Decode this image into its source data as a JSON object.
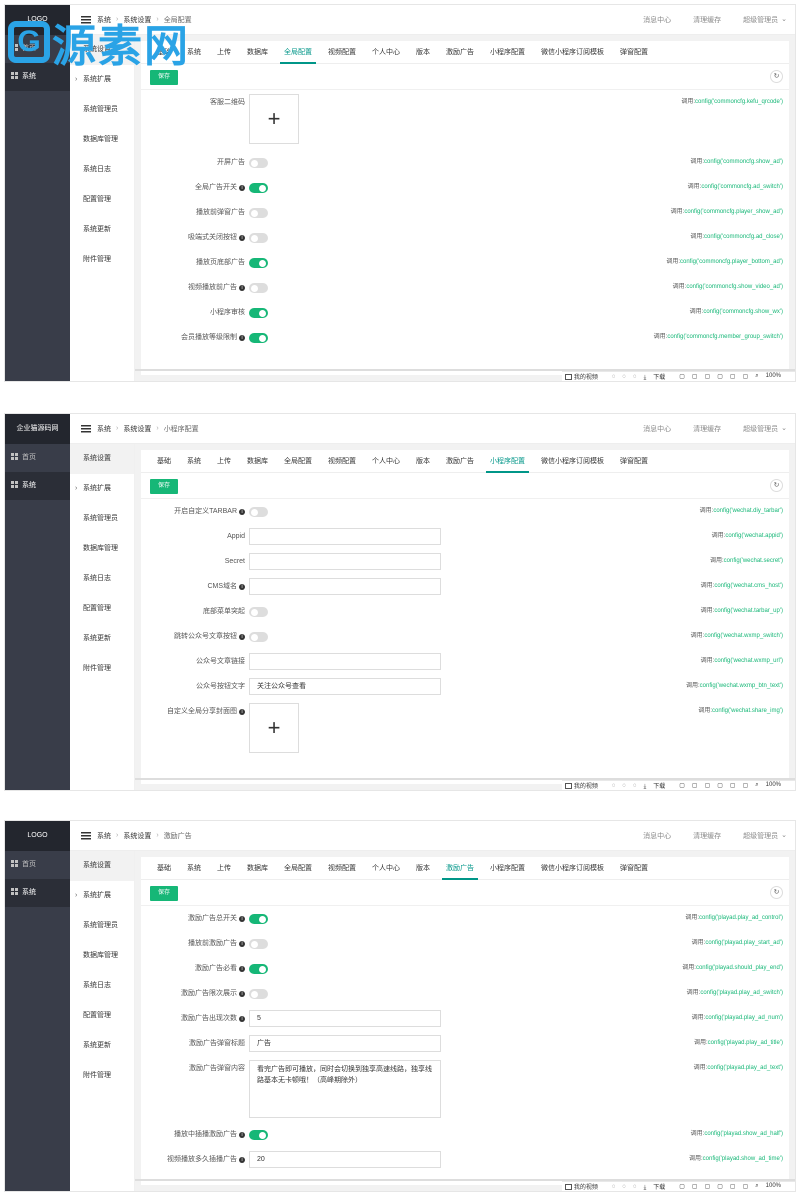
{
  "watermark": {
    "letter": "G",
    "text": "源素网"
  },
  "screens": [
    {
      "logo": "LOGO",
      "side_nav": [
        "首页",
        "系统"
      ],
      "breadcrumb": [
        "系统",
        "系统设置",
        "全局配置"
      ],
      "top_right": [
        "消息中心",
        "清理缓存",
        "超级管理员"
      ],
      "sub_menu": [
        "系统设置",
        "系统扩展",
        "系统管理员",
        "数据库管理",
        "系统日志",
        "配置管理",
        "系统更新",
        "附件管理"
      ],
      "tabs": [
        "基础",
        "系统",
        "上传",
        "数据库",
        "全局配置",
        "视频配置",
        "个人中心",
        "版本",
        "激励广告",
        "小程序配置",
        "微信小程序订阅模板",
        "弹窗配置"
      ],
      "active_tab": "全局配置",
      "save_label": "保存",
      "call_prefix": "调用:",
      "rows": [
        {
          "type": "upload",
          "label": "客服二维码",
          "icon": "plus-icon",
          "call": "config('commoncfg.kefu_qrcode')"
        },
        {
          "type": "switch",
          "label": "开屏广告",
          "on": false,
          "call": "config('commoncfg.show_ad')"
        },
        {
          "type": "switch",
          "label": "全局广告开关",
          "on": true,
          "info": true,
          "call": "config('commoncfg.ad_switch')"
        },
        {
          "type": "switch",
          "label": "播放前弹窗广告",
          "on": false,
          "call": "config('commoncfg.player_show_ad')"
        },
        {
          "type": "switch",
          "label": "吸端式关闭按钮",
          "on": false,
          "info": true,
          "call": "config('commoncfg.ad_close')"
        },
        {
          "type": "switch",
          "label": "播放页底部广告",
          "on": true,
          "call": "config('commoncfg.player_bottom_ad')"
        },
        {
          "type": "switch",
          "label": "视频播放前广告",
          "on": false,
          "info": true,
          "call": "config('commoncfg.show_video_ad')"
        },
        {
          "type": "switch",
          "label": "小程序审核",
          "on": true,
          "call": "config('commoncfg.show_wx')"
        },
        {
          "type": "switch",
          "label": "会员播放等级限制",
          "on": true,
          "info": true,
          "call": "config('commoncfg.member_group_switch')"
        }
      ],
      "status_items": [
        "我的视频",
        "下载",
        "100%"
      ]
    },
    {
      "logo": "企业猫源码网",
      "side_nav": [
        "首页",
        "系统"
      ],
      "breadcrumb": [
        "系统",
        "系统设置",
        "小程序配置"
      ],
      "top_right": [
        "消息中心",
        "清理缓存",
        "超级管理员"
      ],
      "sub_menu": [
        "系统设置",
        "系统扩展",
        "系统管理员",
        "数据库管理",
        "系统日志",
        "配置管理",
        "系统更新",
        "附件管理"
      ],
      "tabs": [
        "基础",
        "系统",
        "上传",
        "数据库",
        "全局配置",
        "视频配置",
        "个人中心",
        "版本",
        "激励广告",
        "小程序配置",
        "微信小程序订阅模板",
        "弹窗配置"
      ],
      "active_tab": "小程序配置",
      "save_label": "保存",
      "call_prefix": "调用:",
      "rows": [
        {
          "type": "switch",
          "label": "开启自定义TARBAR",
          "on": false,
          "info": true,
          "call": "config('wechat.diy_tarbar')"
        },
        {
          "type": "input",
          "label": "Appid",
          "value": "",
          "call": "config('wechat.appid')"
        },
        {
          "type": "input",
          "label": "Secret",
          "value": "",
          "call": "config('wechat.secret')"
        },
        {
          "type": "input",
          "label": "CMS域名",
          "value": "",
          "info": true,
          "call": "config('wechat.cms_host')"
        },
        {
          "type": "switch",
          "label": "底部菜单突起",
          "on": false,
          "call": "config('wechat.tarbar_up')"
        },
        {
          "type": "switch",
          "label": "跳转公众号文章按钮",
          "on": false,
          "info": true,
          "call": "config('wechat.wxmp_switch')"
        },
        {
          "type": "input",
          "label": "公众号文章链接",
          "value": "",
          "call": "config('wechat.wxmp_url')"
        },
        {
          "type": "input",
          "label": "公众号按钮文字",
          "value": "关注公众号查看",
          "call": "config('wechat.wxmp_btn_text')"
        },
        {
          "type": "upload",
          "label": "自定义全局分享封面图",
          "icon": "plus-icon",
          "info": true,
          "call": "config('wechat.share_img')"
        }
      ],
      "status_items": [
        "我的视频",
        "下载",
        "100%"
      ]
    },
    {
      "logo": "LOGO",
      "side_nav": [
        "首页",
        "系统"
      ],
      "breadcrumb": [
        "系统",
        "系统设置",
        "激励广告"
      ],
      "top_right": [
        "消息中心",
        "清理缓存",
        "超级管理员"
      ],
      "sub_menu": [
        "系统设置",
        "系统扩展",
        "系统管理员",
        "数据库管理",
        "系统日志",
        "配置管理",
        "系统更新",
        "附件管理"
      ],
      "tabs": [
        "基础",
        "系统",
        "上传",
        "数据库",
        "全局配置",
        "视频配置",
        "个人中心",
        "版本",
        "激励广告",
        "小程序配置",
        "微信小程序订阅模板",
        "弹窗配置"
      ],
      "active_tab": "激励广告",
      "save_label": "保存",
      "call_prefix": "调用:",
      "rows": [
        {
          "type": "switch",
          "label": "激励广告总开关",
          "on": true,
          "info": true,
          "call": "config('playad.play_ad_control')"
        },
        {
          "type": "switch",
          "label": "播放前激励广告",
          "on": false,
          "info": true,
          "call": "config('playad.play_start_ad')"
        },
        {
          "type": "switch",
          "label": "激励广告必看",
          "on": true,
          "info": true,
          "call": "config('playad.should_play_end')"
        },
        {
          "type": "switch",
          "label": "激励广告限次展示",
          "on": false,
          "info": true,
          "call": "config('playad.play_ad_switch')"
        },
        {
          "type": "input",
          "label": "激励广告出现次数",
          "value": "5",
          "info": true,
          "call": "config('playad.play_ad_num')"
        },
        {
          "type": "input",
          "label": "激励广告弹窗标题",
          "value": "广告",
          "call": "config('playad.play_ad_title')"
        },
        {
          "type": "textarea",
          "label": "激励广告弹窗内容",
          "value": "看完广告即可播放，同时会切换到独享高速线路，独享线路基本无卡顿哦！（高峰期除外）",
          "call": "config('playad.play_ad_text')"
        },
        {
          "type": "switch",
          "label": "播放中插播激励广告",
          "on": true,
          "info": true,
          "call": "config('playad.show_ad_half')"
        },
        {
          "type": "input",
          "label": "视频播放多久插播广告",
          "value": "20",
          "info": true,
          "call": "config('playad.show_ad_time')"
        }
      ],
      "status_items": [
        "我的视频",
        "下载",
        "100%"
      ]
    }
  ]
}
